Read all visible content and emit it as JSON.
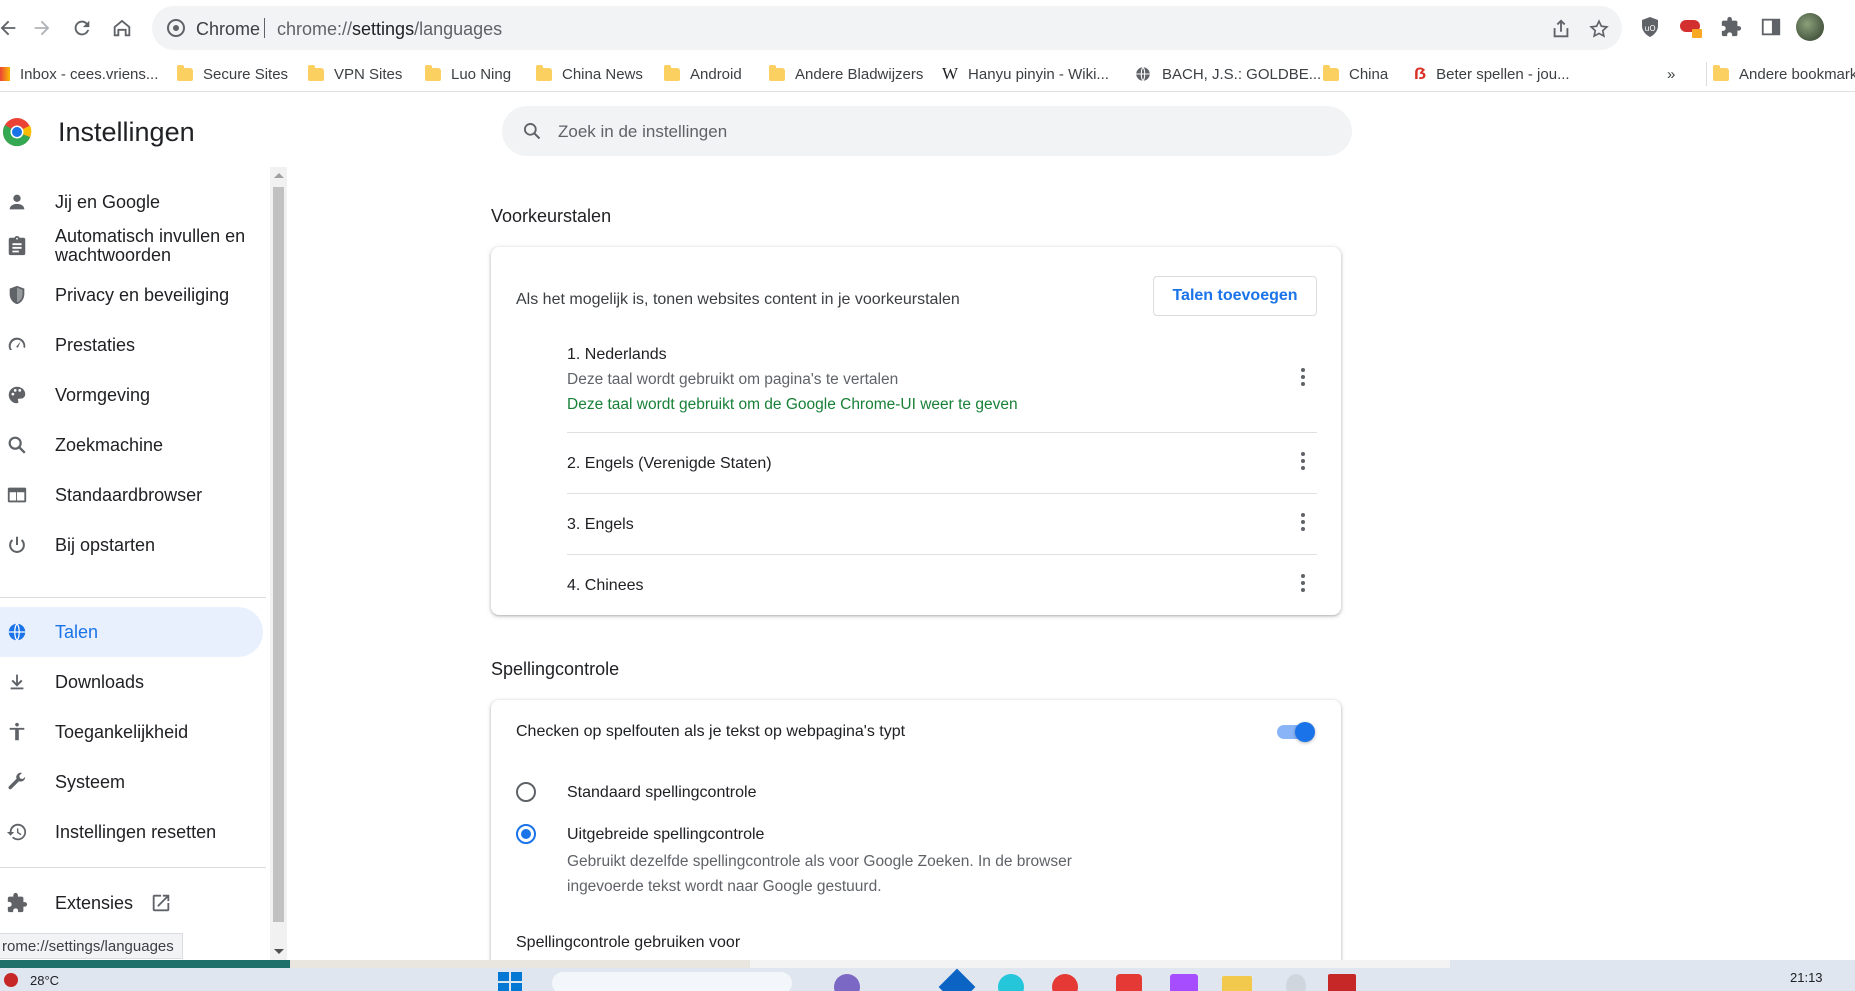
{
  "browser": {
    "omnibox": {
      "site_label": "Chrome",
      "url_prefix": "chrome://",
      "url_host": "settings",
      "url_path": "/languages"
    }
  },
  "bookmarks": [
    {
      "label": "Inbox - cees.vriens...",
      "icon": "gmail-icon"
    },
    {
      "label": "Secure Sites",
      "icon": "folder-icon"
    },
    {
      "label": "VPN Sites",
      "icon": "folder-icon"
    },
    {
      "label": "Luo Ning",
      "icon": "folder-icon"
    },
    {
      "label": "China News",
      "icon": "folder-icon"
    },
    {
      "label": "Android",
      "icon": "folder-icon"
    },
    {
      "label": "Andere Bladwijzers",
      "icon": "folder-icon"
    },
    {
      "label": "Hanyu pinyin - Wiki...",
      "icon": "wikipedia-icon"
    },
    {
      "label": "BACH, J.S.: GOLDBE...",
      "icon": "globe-icon"
    },
    {
      "label": "China",
      "icon": "folder-icon"
    },
    {
      "label": "Beter spellen - jou...",
      "icon": "beter-spellen-icon"
    }
  ],
  "bookmarks_overflow": "»",
  "other_bookmarks": "Andere bookmarks",
  "settings": {
    "title": "Instellingen",
    "search_placeholder": "Zoek in de instellingen"
  },
  "sidebar": {
    "items": [
      {
        "label": "Jij en Google",
        "icon": "person-icon"
      },
      {
        "label": "Automatisch invullen en wachtwoorden",
        "icon": "clipboard-icon"
      },
      {
        "label": "Privacy en beveiliging",
        "icon": "shield-icon"
      },
      {
        "label": "Prestaties",
        "icon": "speedometer-icon"
      },
      {
        "label": "Vormgeving",
        "icon": "palette-icon"
      },
      {
        "label": "Zoekmachine",
        "icon": "search-icon"
      },
      {
        "label": "Standaardbrowser",
        "icon": "browser-window-icon"
      },
      {
        "label": "Bij opstarten",
        "icon": "power-icon"
      },
      {
        "label": "Talen",
        "icon": "globe-icon",
        "active": true
      },
      {
        "label": "Downloads",
        "icon": "download-icon"
      },
      {
        "label": "Toegankelijkheid",
        "icon": "accessibility-icon"
      },
      {
        "label": "Systeem",
        "icon": "wrench-icon"
      },
      {
        "label": "Instellingen resetten",
        "icon": "history-icon"
      },
      {
        "label": "Extensies",
        "icon": "puzzle-icon"
      }
    ]
  },
  "languages_section": {
    "title": "Voorkeurstalen",
    "description": "Als het mogelijk is, tonen websites content in je voorkeurstalen",
    "add_button": "Talen toevoegen",
    "languages": [
      {
        "name": "1. Nederlands",
        "note": "Deze taal wordt gebruikt om pagina's te vertalen",
        "ui_note": "Deze taal wordt gebruikt om de Google Chrome-UI weer te geven"
      },
      {
        "name": "2. Engels (Verenigde Staten)"
      },
      {
        "name": "3. Engels"
      },
      {
        "name": "4. Chinees"
      }
    ]
  },
  "spelling_section": {
    "title": "Spellingcontrole",
    "toggle_label": "Checken op spelfouten als je tekst op webpagina's typt",
    "toggle_on": true,
    "options": [
      {
        "label": "Standaard spellingcontrole",
        "checked": false
      },
      {
        "label": "Uitgebreide spellingcontrole",
        "checked": true,
        "description": "Gebruikt dezelfde spellingcontrole als voor Google Zoeken. In de browser ingevoerde tekst wordt naar Google gestuurd."
      }
    ],
    "use_for_label": "Spellingcontrole gebruiken voor"
  },
  "status_bar": {
    "url": "rome://settings/languages"
  },
  "taskbar": {
    "temperature": "28°C",
    "time": "21:13"
  },
  "colors": {
    "accent": "#1a73e8",
    "active_bg": "#e8f0fe",
    "green_note": "#188038"
  }
}
